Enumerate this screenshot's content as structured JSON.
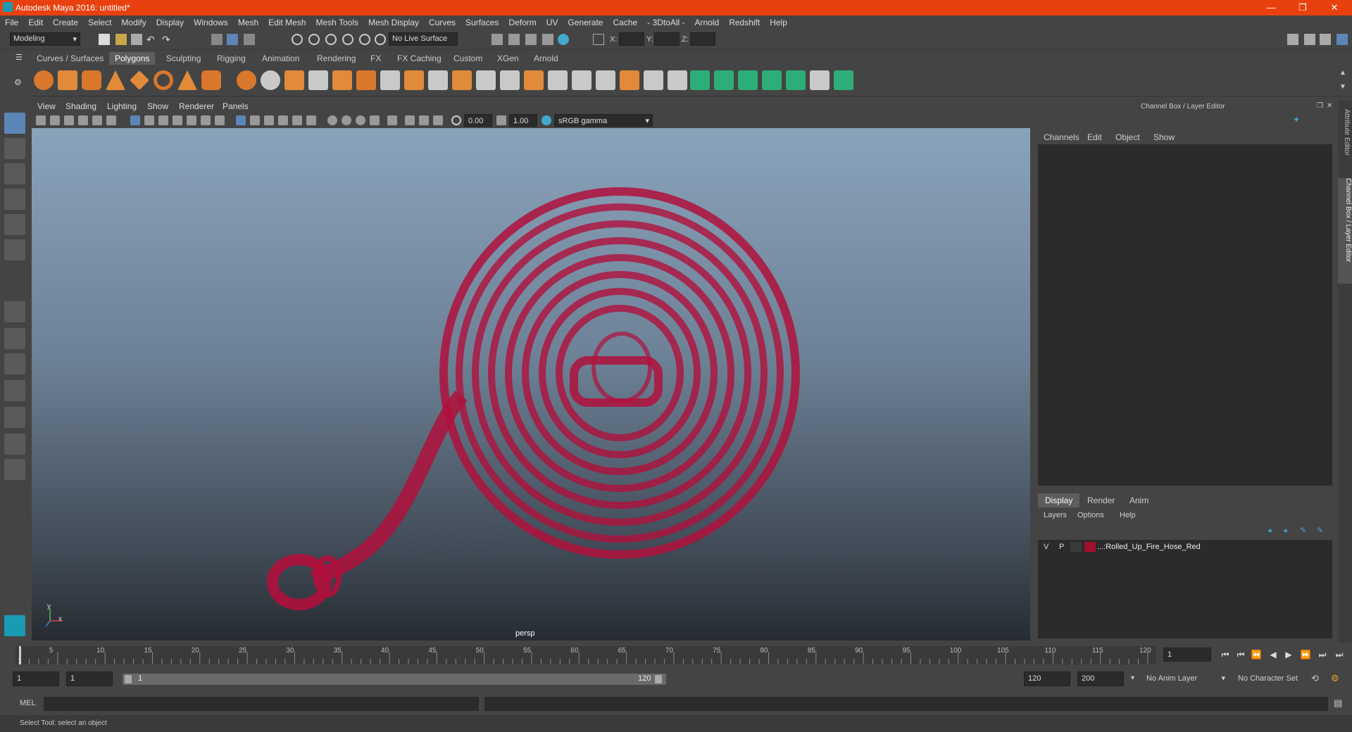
{
  "window": {
    "title": "Autodesk Maya 2016: untitled*",
    "minimize": "—",
    "restore": "❐",
    "close": "✕"
  },
  "menu": [
    "File",
    "Edit",
    "Create",
    "Select",
    "Modify",
    "Display",
    "Windows",
    "Mesh",
    "Edit Mesh",
    "Mesh Tools",
    "Mesh Display",
    "Curves",
    "Surfaces",
    "Deform",
    "UV",
    "Generate",
    "Cache",
    "- 3DtoAll -",
    "Arnold",
    "Redshift",
    "Help"
  ],
  "status": {
    "mode": "Modeling",
    "live_surface": "No Live Surface",
    "x_label": "X:",
    "y_label": "Y:",
    "z_label": "Z:"
  },
  "shelf_tabs": [
    "Curves / Surfaces",
    "Polygons",
    "Sculpting",
    "Rigging",
    "Animation",
    "Rendering",
    "FX",
    "FX Caching",
    "Custom",
    "XGen",
    "Arnold"
  ],
  "shelf_active": "Polygons",
  "viewport": {
    "menus": [
      "View",
      "Shading",
      "Lighting",
      "Show",
      "Renderer",
      "Panels"
    ],
    "exposure": "0.00",
    "gamma": "1.00",
    "color_space": "sRGB gamma",
    "camera_label": "persp",
    "axis_x": "x",
    "axis_y": "y",
    "wire_color": "#b0103c"
  },
  "channel_box": {
    "title": "Channel Box / Layer Editor",
    "menus": [
      "Channels",
      "Edit",
      "Object",
      "Show"
    ],
    "side_tabs": [
      "Attribute Editor",
      "Channel Box / Layer Editor"
    ]
  },
  "layer_editor": {
    "tabs": [
      "Display",
      "Render",
      "Anim"
    ],
    "active_tab": "Display",
    "menus": [
      "Layers",
      "Options",
      "Help"
    ],
    "layers": [
      {
        "v": "V",
        "p": "P",
        "color": "#a0102c",
        "name": "...:Rolled_Up_Fire_Hose_Red"
      }
    ]
  },
  "timeline": {
    "ticks": [
      "5",
      "10",
      "15",
      "20",
      "25",
      "30",
      "35",
      "40",
      "45",
      "50",
      "55",
      "60",
      "65",
      "70",
      "75",
      "80",
      "85",
      "90",
      "95",
      "100",
      "105",
      "110",
      "115",
      "120"
    ],
    "start_tick": "1",
    "current_frame": "1"
  },
  "range": {
    "start": "1",
    "anim_start": "1",
    "slider_start": "1",
    "slider_end": "120",
    "end": "120",
    "anim_end": "200",
    "anim_layer": "No Anim Layer",
    "character_set": "No Character Set"
  },
  "mel": {
    "label": "MEL"
  },
  "help_line": "Select Tool: select an object"
}
